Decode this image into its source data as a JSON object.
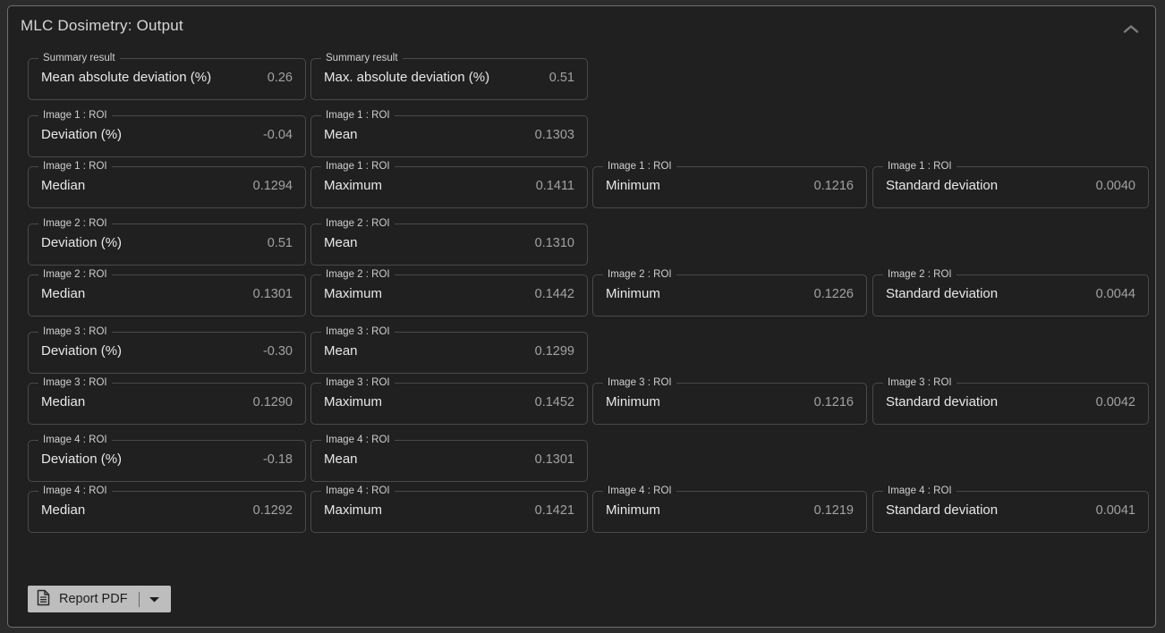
{
  "panel": {
    "title": "MLC Dosimetry: Output",
    "collapse_icon": "chevron-up-icon"
  },
  "rows": [
    {
      "group": "summary",
      "gap_after": true,
      "cards": [
        {
          "legend": "Summary result",
          "label": "Mean absolute deviation (%)",
          "value": "0.26"
        },
        {
          "legend": "Summary result",
          "label": "Max. absolute deviation (%)",
          "value": "0.51"
        }
      ]
    },
    {
      "group": "image-1-a",
      "gap_after": false,
      "cards": [
        {
          "legend": "Image 1 : ROI",
          "label": "Deviation (%)",
          "value": "-0.04"
        },
        {
          "legend": "Image 1 : ROI",
          "label": "Mean",
          "value": "0.1303"
        }
      ]
    },
    {
      "group": "image-1-b",
      "gap_after": true,
      "cards": [
        {
          "legend": "Image 1 : ROI",
          "label": "Median",
          "value": "0.1294"
        },
        {
          "legend": "Image 1 : ROI",
          "label": "Maximum",
          "value": "0.1411"
        },
        {
          "legend": "Image 1 : ROI",
          "label": "Minimum",
          "value": "0.1216"
        },
        {
          "legend": "Image 1 : ROI",
          "label": "Standard deviation",
          "value": "0.0040"
        }
      ]
    },
    {
      "group": "image-2-a",
      "gap_after": false,
      "cards": [
        {
          "legend": "Image 2 : ROI",
          "label": "Deviation (%)",
          "value": "0.51"
        },
        {
          "legend": "Image 2 : ROI",
          "label": "Mean",
          "value": "0.1310"
        }
      ]
    },
    {
      "group": "image-2-b",
      "gap_after": true,
      "cards": [
        {
          "legend": "Image 2 : ROI",
          "label": "Median",
          "value": "0.1301"
        },
        {
          "legend": "Image 2 : ROI",
          "label": "Maximum",
          "value": "0.1442"
        },
        {
          "legend": "Image 2 : ROI",
          "label": "Minimum",
          "value": "0.1226"
        },
        {
          "legend": "Image 2 : ROI",
          "label": "Standard deviation",
          "value": "0.0044"
        }
      ]
    },
    {
      "group": "image-3-a",
      "gap_after": false,
      "cards": [
        {
          "legend": "Image 3 : ROI",
          "label": "Deviation (%)",
          "value": "-0.30"
        },
        {
          "legend": "Image 3 : ROI",
          "label": "Mean",
          "value": "0.1299"
        }
      ]
    },
    {
      "group": "image-3-b",
      "gap_after": true,
      "cards": [
        {
          "legend": "Image 3 : ROI",
          "label": "Median",
          "value": "0.1290"
        },
        {
          "legend": "Image 3 : ROI",
          "label": "Maximum",
          "value": "0.1452"
        },
        {
          "legend": "Image 3 : ROI",
          "label": "Minimum",
          "value": "0.1216"
        },
        {
          "legend": "Image 3 : ROI",
          "label": "Standard deviation",
          "value": "0.0042"
        }
      ]
    },
    {
      "group": "image-4-a",
      "gap_after": false,
      "cards": [
        {
          "legend": "Image 4 : ROI",
          "label": "Deviation (%)",
          "value": "-0.18"
        },
        {
          "legend": "Image 4 : ROI",
          "label": "Mean",
          "value": "0.1301"
        }
      ]
    },
    {
      "group": "image-4-b",
      "gap_after": false,
      "cards": [
        {
          "legend": "Image 4 : ROI",
          "label": "Median",
          "value": "0.1292"
        },
        {
          "legend": "Image 4 : ROI",
          "label": "Maximum",
          "value": "0.1421"
        },
        {
          "legend": "Image 4 : ROI",
          "label": "Minimum",
          "value": "0.1219"
        },
        {
          "legend": "Image 4 : ROI",
          "label": "Standard deviation",
          "value": "0.0041"
        }
      ]
    }
  ],
  "footer": {
    "report_pdf_label": "Report PDF",
    "document_icon": "document-icon",
    "dropdown_icon": "caret-down-icon"
  },
  "colors": {
    "page_background": "#2b2b2b",
    "panel_background": "#202020",
    "panel_border": "#6e6e6e",
    "card_border": "#4a4a4a",
    "label_text": "#e8e8e8",
    "value_text": "#a2a2a2",
    "legend_text": "#cfcfcf",
    "title_text": "#d6d6d6",
    "button_background": "#bdbdbd",
    "button_text": "#1d1d1d"
  }
}
